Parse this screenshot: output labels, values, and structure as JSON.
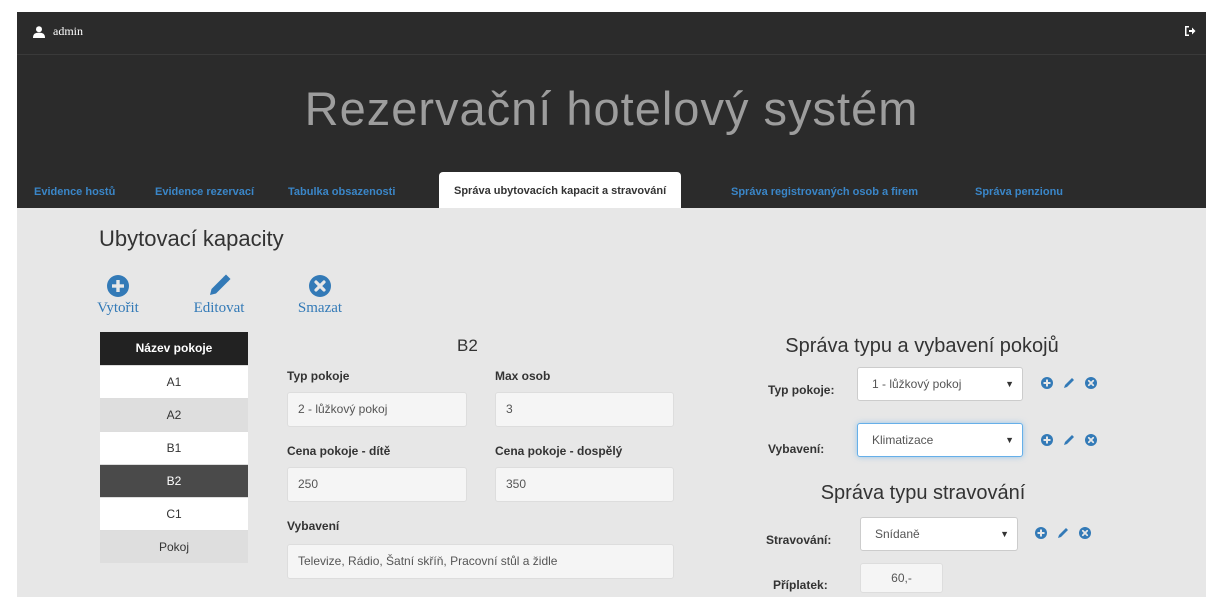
{
  "user": {
    "name": "admin",
    "icon": "user-icon"
  },
  "header": {
    "title": "Rezervační hotelový systém",
    "logout_icon": "logout-icon"
  },
  "nav": {
    "tabs": [
      {
        "label": "Evidence hostů"
      },
      {
        "label": "Evidence rezervací"
      },
      {
        "label": "Tabulka obsazenosti"
      },
      {
        "label": "Správa ubytovacích kapacit a stravování",
        "active": true
      },
      {
        "label": "Správa registrovaných osob a firem"
      },
      {
        "label": "Správa penzionu"
      }
    ]
  },
  "capacities": {
    "heading": "Ubytovací kapacity",
    "toolbar": {
      "create_label": "Vytořit",
      "edit_label": "Editovat",
      "delete_label": "Smazat"
    },
    "rooms": {
      "header": "Název pokoje",
      "items": [
        "A1",
        "A2",
        "B1",
        "B2",
        "C1",
        "Pokoj"
      ],
      "selected": "B2"
    },
    "detail": {
      "name": "B2",
      "type_label": "Typ pokoje",
      "type_value": "2 - lůžkový pokoj",
      "max_label": "Max osob",
      "max_value": "3",
      "child_price_label": "Cena pokoje - dítě",
      "child_price_value": "250",
      "adult_price_label": "Cena pokoje - dospělý",
      "adult_price_value": "350",
      "equipment_label": "Vybavení",
      "equipment_value": "Televize, Rádio, Šatní skříň, Pracovní stůl a židle"
    }
  },
  "room_types": {
    "heading": "Správa typu a vybavení pokojů",
    "type_label": "Typ pokoje:",
    "type_value": "1 - lůžkový pokoj",
    "equipment_label": "Vybavení:",
    "equipment_value": "Klimatizace"
  },
  "boarding": {
    "heading": "Správa typu stravování",
    "type_label": "Stravování:",
    "type_value": "Snídaně",
    "surcharge_label": "Příplatek:",
    "surcharge_value": "60,-"
  },
  "colors": {
    "accent": "#337ab7",
    "dark": "#2b2b2b",
    "title": "#9d9d9d"
  }
}
